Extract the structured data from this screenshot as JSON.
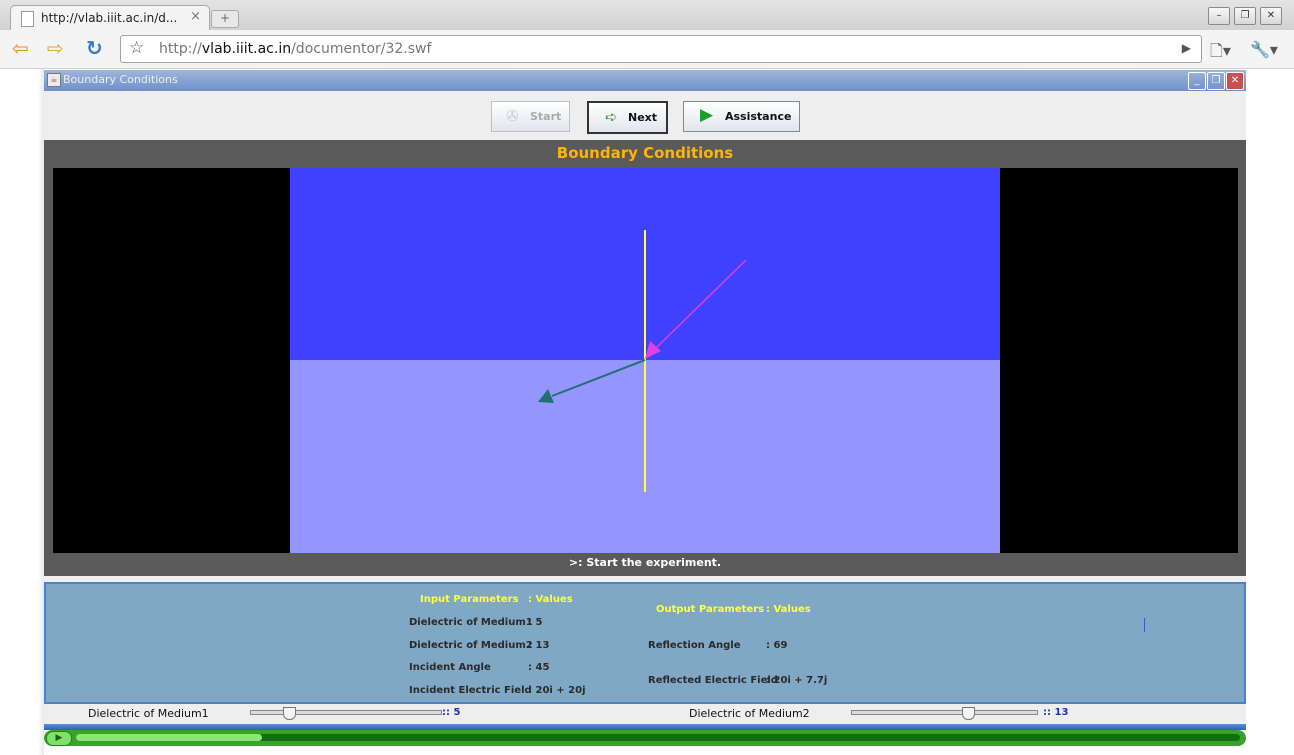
{
  "browser": {
    "tab_title": "http://vlab.iiit.ac.in/d...",
    "tab_close": "×",
    "new_tab": "+",
    "url_scheme": "http://",
    "url_host": "vlab.iiit.ac.in",
    "url_path": "/documentor/32.swf",
    "window_buttons": {
      "minimize": "–",
      "restore": "❐",
      "close": "✕"
    }
  },
  "app": {
    "window_title": "Boundary Conditions",
    "toolbar": {
      "start_label": "Start",
      "next_label": "Next",
      "assistance_label": "Assistance"
    },
    "stage": {
      "title": "Boundary Conditions",
      "status": ">: Start the experiment.",
      "colors": {
        "upper_medium": "#4040ff",
        "lower_medium": "#9595ff",
        "normal_line": "#ffff40",
        "incident_ray": "#e040e0",
        "refracted_ray": "#207070"
      }
    },
    "parameters": {
      "input_header": "Input Parameters",
      "input_values_header": ": Values",
      "inputs": [
        {
          "label": "Dielectric of Medium1",
          "value": ": 5"
        },
        {
          "label": "Dielectric of Medium2",
          "value": ": 13"
        },
        {
          "label": "Incident Angle",
          "value": ": 45"
        },
        {
          "label": "Incident Electric Field",
          "value": ": 20i + 20j"
        }
      ],
      "output_header": "Output Parameters",
      "output_values_header": ": Values",
      "outputs": [
        {
          "label": "Reflection Angle",
          "value": ": 69"
        },
        {
          "label": "Reflected Electric Field",
          "value": ": 20i + 7.7j"
        }
      ]
    },
    "sliders": [
      {
        "label": "Dielectric of Medium1",
        "value": ":: 5"
      },
      {
        "label": "Dielectric of Medium2",
        "value": ":: 13"
      }
    ],
    "player": {
      "play_symbol": "▶",
      "progress": 0.16
    }
  }
}
